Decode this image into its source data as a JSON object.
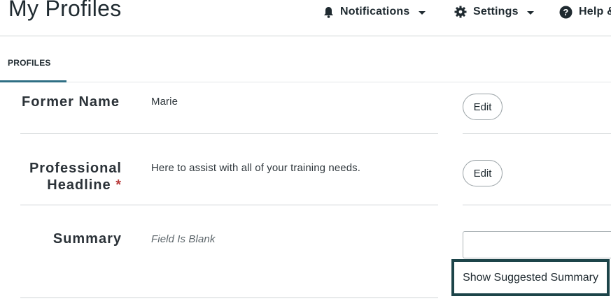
{
  "header": {
    "title": "My Profiles",
    "nav": {
      "notifications": {
        "label": "Notifications",
        "icon": "bell-icon"
      },
      "settings": {
        "label": "Settings",
        "icon": "gear-icon"
      },
      "help": {
        "label": "Help &",
        "icon": "question-circle-icon"
      }
    }
  },
  "tabs": [
    {
      "label": "PROFILES",
      "active": true
    }
  ],
  "fields": {
    "former_name": {
      "label": "Former Name",
      "value": "Marie",
      "action": "Edit"
    },
    "headline": {
      "label_line1": "Professional",
      "label_line2": "Headline",
      "required_mark": "*",
      "value": "Here to assist with all of your training needs.",
      "action": "Edit"
    },
    "summary": {
      "label": "Summary",
      "value": "Field Is Blank",
      "input_value": "",
      "suggest_label": "Show Suggested Summary"
    }
  },
  "colors": {
    "accent": "#2f6f84",
    "focus_outline": "#1c4449",
    "required": "#b83a3a"
  }
}
